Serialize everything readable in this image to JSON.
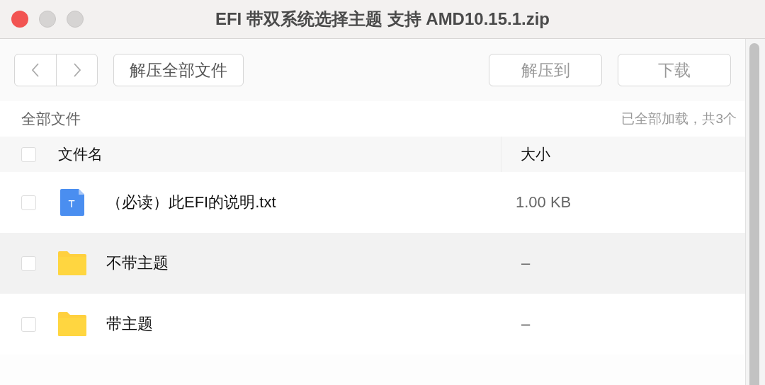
{
  "window": {
    "title": "EFI 带双系统选择主题 支持 AMD10.15.1.zip"
  },
  "toolbar": {
    "extract_all": {
      "label": "解压全部文件",
      "disabled": false
    },
    "extract_to": {
      "label": "解压到",
      "disabled": true
    },
    "download": {
      "label": "下载",
      "disabled": true
    }
  },
  "breadcrumb": "全部文件",
  "status": "已全部加载，共3个",
  "table": {
    "header_checked": false,
    "columns": [
      "文件名",
      "大小"
    ],
    "rows": [
      {
        "kind": "text",
        "icon_letter": "T",
        "name": "（必读）此EFI的说明.txt",
        "size": "1.00 KB",
        "checked": false,
        "hovered": false
      },
      {
        "kind": "folder",
        "name": "不带主题",
        "size": "–",
        "checked": false,
        "hovered": true
      },
      {
        "kind": "folder",
        "name": "带主题",
        "size": "–",
        "checked": false,
        "hovered": false
      }
    ]
  }
}
